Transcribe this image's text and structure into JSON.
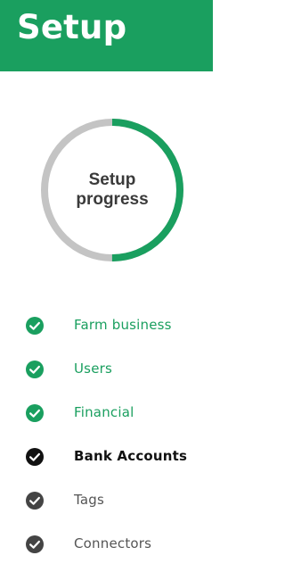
{
  "header": {
    "title": "Setup"
  },
  "progress": {
    "label_line1": "Setup",
    "label_line2": "progress",
    "fraction": 0.5,
    "colors": {
      "complete": "#1a9f5f",
      "track": "#c4c4c4"
    }
  },
  "steps": [
    {
      "label": "Farm business",
      "status": "complete",
      "icon": "check-circle-icon"
    },
    {
      "label": "Users",
      "status": "complete",
      "icon": "check-circle-icon"
    },
    {
      "label": "Financial",
      "status": "complete",
      "icon": "check-circle-icon"
    },
    {
      "label": "Bank Accounts",
      "status": "active",
      "icon": "check-circle-icon"
    },
    {
      "label": "Tags",
      "status": "pending",
      "icon": "check-circle-icon"
    },
    {
      "label": "Connectors",
      "status": "pending",
      "icon": "check-circle-icon"
    }
  ],
  "colors": {
    "brand_green": "#1a9f5f",
    "active_icon": "#111111",
    "pending_icon": "#444444"
  }
}
